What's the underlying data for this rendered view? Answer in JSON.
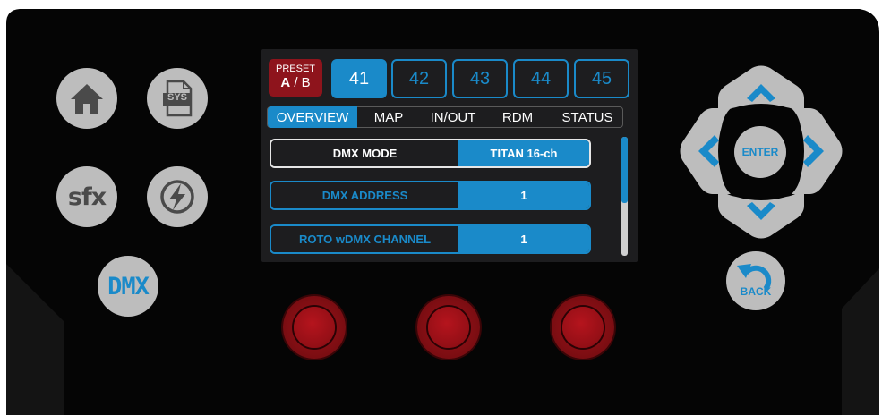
{
  "colors": {
    "accent": "#1a8ac9",
    "preset_bg": "#8e141c",
    "panel_bg": "#050505",
    "button_gray": "#bdbdbd",
    "knob_red": "#9d1118"
  },
  "left_buttons": [
    {
      "name": "home",
      "icon": "home-icon"
    },
    {
      "name": "sys",
      "icon": "sys-file-icon",
      "label": "SYS"
    },
    {
      "name": "sfx",
      "label": "sfx"
    },
    {
      "name": "effects",
      "icon": "lightning-icon"
    },
    {
      "name": "dmx",
      "label": "DMX"
    }
  ],
  "preset": {
    "title": "PRESET",
    "a": "A",
    "sep": " / ",
    "b": "B"
  },
  "preset_tabs": [
    "41",
    "42",
    "43",
    "44",
    "45"
  ],
  "active_preset": "41",
  "tabs": [
    "OVERVIEW",
    "MAP",
    "IN/OUT",
    "RDM",
    "STATUS"
  ],
  "active_tab": "OVERVIEW",
  "rows": [
    {
      "label": "DMX MODE",
      "value": "TITAN 16-ch"
    },
    {
      "label": "DMX ADDRESS",
      "value": "1"
    },
    {
      "label": "ROTO wDMX CHANNEL",
      "value": "1"
    }
  ],
  "nav": {
    "enter": "ENTER",
    "back": "BACK"
  }
}
